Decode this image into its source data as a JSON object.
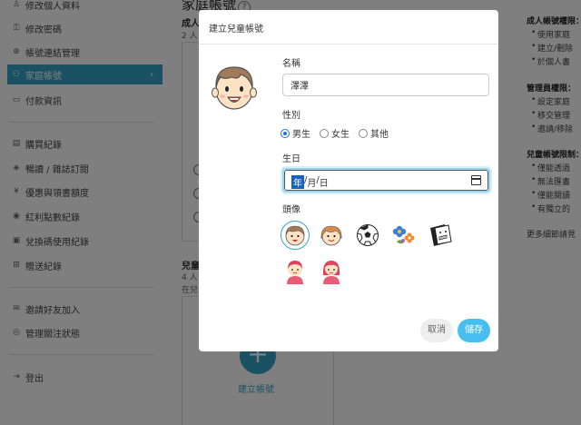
{
  "sidebar": {
    "items": [
      {
        "label": "修改個人資料",
        "icon": "user-icon"
      },
      {
        "label": "修改密碼",
        "icon": "lock-icon"
      },
      {
        "label": "帳號連結管理",
        "icon": "link-icon"
      },
      {
        "label": "家庭帳號",
        "icon": "family-icon",
        "active": true
      },
      {
        "label": "付款資訊",
        "icon": "card-icon"
      },
      {
        "label": "購買紀錄",
        "icon": "receipt-icon"
      },
      {
        "label": "暢讀 / 雜誌訂閱",
        "icon": "book-icon"
      },
      {
        "label": "優惠與領書額度",
        "icon": "coupon-icon"
      },
      {
        "label": "紅利點數紀錄",
        "icon": "point-icon"
      },
      {
        "label": "兌換碼使用紀錄",
        "icon": "code-icon"
      },
      {
        "label": "贈送紀錄",
        "icon": "gift-icon"
      },
      {
        "label": "邀請好友加入",
        "icon": "mail-icon"
      },
      {
        "label": "管理關注狀態",
        "icon": "eye-icon"
      },
      {
        "label": "登出",
        "icon": "logout-icon"
      }
    ],
    "active_chevron": "›"
  },
  "main": {
    "title": "家庭帳號",
    "help": "?",
    "adult_section_title": "成人",
    "adult_count": "2 人",
    "child_section_title": "兒童",
    "child_count": "4 人",
    "child_note": "在兒",
    "add_button": "+",
    "add_label": "建立帳號"
  },
  "right_panel": {
    "adult_heading": "成人帳號權限：",
    "adult_items": [
      "使用家庭",
      "建立/刪除",
      "於個人書"
    ],
    "admin_heading": "管理員權限：",
    "admin_items": [
      "設定家庭",
      "移交管理",
      "邀請/移除"
    ],
    "child_heading": "兒童帳號限制：",
    "child_items": [
      "僅能透過",
      "無法匯書",
      "僅能閱讀",
      "有獨立的"
    ],
    "more": "更多細節請見"
  },
  "modal": {
    "title": "建立兒童帳號",
    "name_label": "名稱",
    "name_value": "澤澤",
    "gender_label": "性別",
    "gender_options": [
      "男生",
      "女生",
      "其他"
    ],
    "gender_selected": "男生",
    "birthday_label": "生日",
    "date_year": "年",
    "date_sep": "/",
    "date_month": "月",
    "date_day": "日",
    "avatar_label": "頭像",
    "avatars": [
      "boy-face-icon",
      "girl-face-icon",
      "soccer-ball-icon",
      "flowers-icon",
      "comic-face-icon",
      "boy-pink-icon",
      "girl-pink-icon"
    ],
    "cancel_label": "取消",
    "save_label": "儲存"
  },
  "colors": {
    "accent": "#35a5c7",
    "save": "#48bdf0",
    "radio": "#1a73e8",
    "date_highlight": "#1565c0"
  }
}
